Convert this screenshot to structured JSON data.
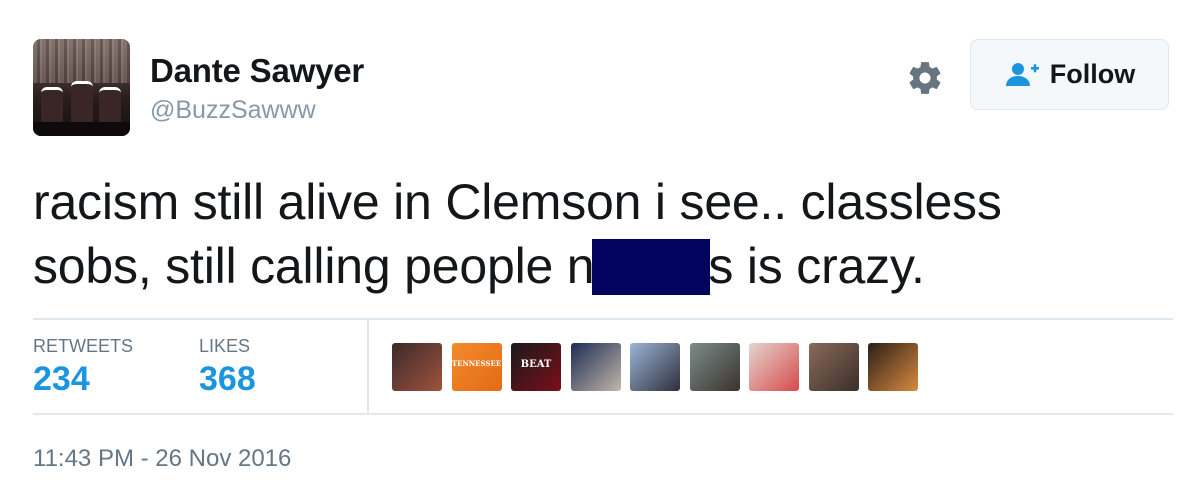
{
  "user": {
    "name": "Dante Sawyer",
    "handle": "@BuzzSawww"
  },
  "actions": {
    "follow_label": "Follow"
  },
  "tweet": {
    "text_line1": "racism still alive in Clemson i see.. classless",
    "text_line2_start": "sobs, still calling people n",
    "text_line2_end": "s is crazy."
  },
  "stats": {
    "retweets_label": "RETWEETS",
    "retweets_count": "234",
    "likes_label": "LIKES",
    "likes_count": "368"
  },
  "likers": [
    {
      "name": "liker-avatar-1",
      "colors": [
        "#3b2a2a",
        "#a0523d"
      ]
    },
    {
      "name": "liker-avatar-2",
      "colors": [
        "#f28b2c",
        "#e46a15"
      ],
      "text": "TENNESSEE"
    },
    {
      "name": "liker-avatar-3",
      "colors": [
        "#1a1a1a",
        "#7a0f1a"
      ],
      "text": "BEAT"
    },
    {
      "name": "liker-avatar-4",
      "colors": [
        "#1d2b55",
        "#c2b7a8"
      ]
    },
    {
      "name": "liker-avatar-5",
      "colors": [
        "#9bb5d6",
        "#2f2f3c"
      ]
    },
    {
      "name": "liker-avatar-6",
      "colors": [
        "#7d8c8a",
        "#3a332d"
      ]
    },
    {
      "name": "liker-avatar-7",
      "colors": [
        "#e2d6cf",
        "#d84a4a"
      ]
    },
    {
      "name": "liker-avatar-8",
      "colors": [
        "#8a6a5a",
        "#3b2e2a"
      ]
    },
    {
      "name": "liker-avatar-9",
      "colors": [
        "#2b1f19",
        "#d88a3e"
      ]
    }
  ],
  "timestamp": "11:43 PM - 26 Nov 2016",
  "colors": {
    "accent": "#1b95e0",
    "redaction": "#03045e",
    "muted": "#657786"
  }
}
